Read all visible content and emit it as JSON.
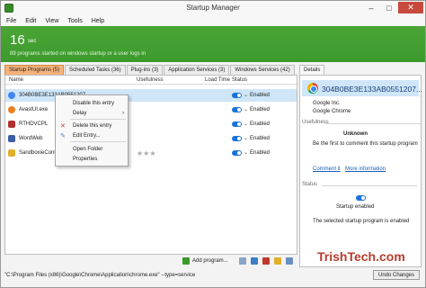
{
  "window": {
    "title": "Startup Manager",
    "minimize": "–",
    "maximize": "□",
    "close": "✕"
  },
  "menu": [
    "File",
    "Edit",
    "View",
    "Tools",
    "Help"
  ],
  "banner": {
    "count": "16",
    "unit": "sec",
    "subtitle": "89 programs started on windows startup or a user logs in",
    "color": "#3f9e2f"
  },
  "tabs": [
    {
      "label": "Startup Programs (5)",
      "active": true
    },
    {
      "label": "Scheduled Tasks (36)",
      "active": false
    },
    {
      "label": "Plug-ins (3)",
      "active": false
    },
    {
      "label": "Application Services (3)",
      "active": false
    },
    {
      "label": "Windows Services (42)",
      "active": false
    }
  ],
  "details_tab": "Details",
  "columns": {
    "name": "Name",
    "usefulness": "Usefulness",
    "load_time": "Load Time",
    "status": "Status"
  },
  "rows": [
    {
      "name": "304B0BE3E133AB0551207...",
      "status": "Enabled",
      "selected": true,
      "icon": "chrome-icon",
      "color": "#4285f4"
    },
    {
      "name": "AvastUI.exe",
      "status": "Enabled",
      "selected": false,
      "icon": "avast-icon",
      "color": "#f07d1e"
    },
    {
      "name": "RTHDVCPL",
      "status": "Enabled",
      "selected": false,
      "icon": "speaker-icon",
      "color": "#b03030"
    },
    {
      "name": "WordWeb",
      "status": "Enabled",
      "selected": false,
      "icon": "wordweb-icon",
      "color": "#3b5ea8"
    },
    {
      "name": "SandboxieControl",
      "status": "Enabled",
      "selected": false,
      "icon": "sandboxie-icon",
      "color": "#e2b02a"
    }
  ],
  "rating_stars": "★★★",
  "context_menu": {
    "items": [
      "Disable this entry",
      "Delay",
      "Delete this entry",
      "Edit Entry...",
      "Open Folder",
      "Properties"
    ],
    "submenu_arrow": "›"
  },
  "bottom_toolbar": {
    "add_program": "Add program..."
  },
  "details": {
    "title": "304B0BE3E133AB0551207...",
    "company": "Google Inc.",
    "product": "Google Chrome",
    "usefulness_header": "Usefulness",
    "usefulness_value": "Unknown",
    "comment_prompt": "Be the first to comment this startup program",
    "comment_link": "Comment it",
    "more_info_link": "More information",
    "status_header": "Status",
    "status_value": "Startup enabled",
    "status_desc": "The selected startup program is enabled"
  },
  "statusbar": {
    "path": "\"C:\\Program Files (x86)\\Google\\Chrome\\Application\\chrome.exe\" --type=service",
    "undo": "Undo Changes"
  },
  "watermark": "TrishTech.com"
}
